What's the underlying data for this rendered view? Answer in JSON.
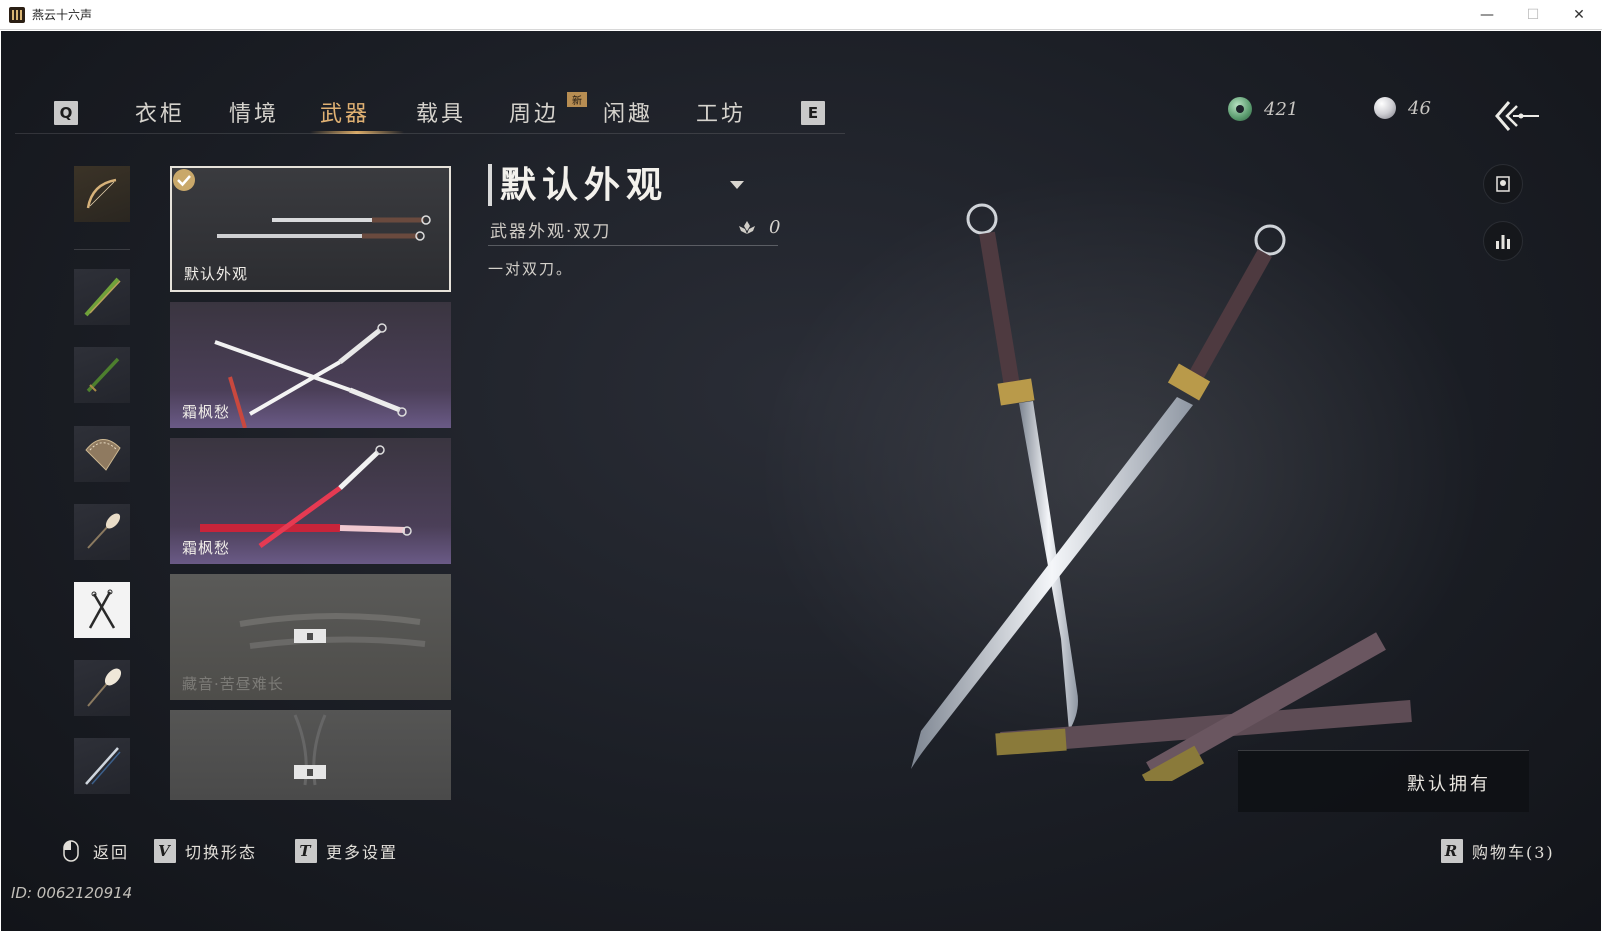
{
  "window": {
    "title": "燕云十六声",
    "minimize": "—",
    "maximize": "☐",
    "close": "✕"
  },
  "nav": {
    "left_key": "Q",
    "right_key": "E",
    "tabs": [
      {
        "label": "衣柜"
      },
      {
        "label": "情境"
      },
      {
        "label": "武器",
        "active": true
      },
      {
        "label": "载具"
      },
      {
        "label": "周边",
        "badge": "新"
      },
      {
        "label": "闲趣"
      },
      {
        "label": "工坊"
      }
    ]
  },
  "currency": {
    "jade": "421",
    "pearl": "46"
  },
  "categories": [
    {
      "icon": "bow-icon"
    },
    {
      "icon": "green-spear-icon"
    },
    {
      "icon": "green-blade-icon"
    },
    {
      "icon": "fan-icon"
    },
    {
      "icon": "brush-icon"
    },
    {
      "icon": "dual-blades-icon",
      "selected": true
    },
    {
      "icon": "umbrella-icon"
    },
    {
      "icon": "sword-icon"
    }
  ],
  "skins": [
    {
      "label": "默认外观",
      "selected": true
    },
    {
      "label": "霜枫愁"
    },
    {
      "label": "霜枫愁"
    },
    {
      "label": "藏音·苦昼难长",
      "locked": true
    },
    {
      "label": "",
      "locked": true
    }
  ],
  "detail": {
    "title": "默认外观",
    "subtitle": "武器外观·双刀",
    "popularity": "0",
    "description": "一对双刀。"
  },
  "owned_status": "默认拥有",
  "hints": {
    "back": "返回",
    "switch_key": "V",
    "switch": "切换形态",
    "settings_key": "T",
    "settings": "更多设置",
    "cart_key": "R",
    "cart": "购物车(3)"
  },
  "uid": "ID: 0062120914",
  "colors": {
    "accent": "#e0b173",
    "background": "#1b1e25",
    "selected_card_border": "#e6e2da"
  }
}
